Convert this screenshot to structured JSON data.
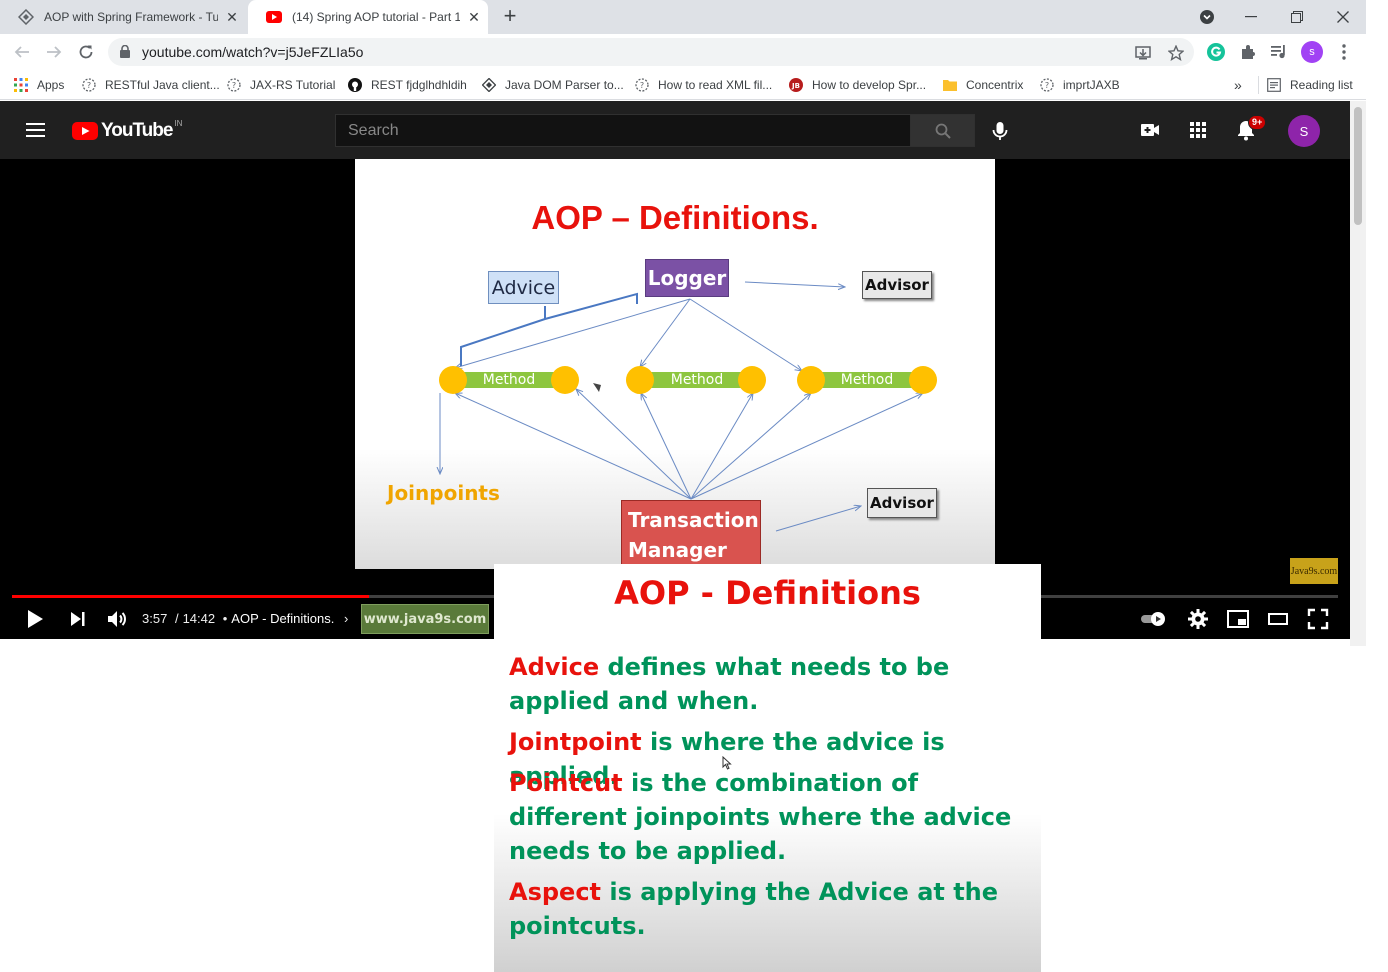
{
  "browser": {
    "tabs": [
      {
        "title": "AOP with Spring Framework - Tu",
        "icon": "spring-favicon",
        "active": false
      },
      {
        "title": "(14) Spring AOP tutorial - Part 1 |",
        "icon": "youtube-favicon",
        "active": true
      }
    ],
    "new_tab_label": "+",
    "url": "youtube.com/watch?v=j5JeFZLIa5o",
    "profile_initial": "s",
    "bookmarks": [
      {
        "label": "Apps",
        "icon": "apps-grid-icon"
      },
      {
        "label": "RESTful Java client...",
        "icon": "page-icon"
      },
      {
        "label": "JAX-RS Tutorial",
        "icon": "page-icon"
      },
      {
        "label": "REST fjdglhdhldih",
        "icon": "github-icon"
      },
      {
        "label": "Java DOM Parser to...",
        "icon": "diamond-icon"
      },
      {
        "label": "How to read XML fil...",
        "icon": "page-icon"
      },
      {
        "label": "How to develop Spr...",
        "icon": "jb-icon"
      },
      {
        "label": "Concentrix",
        "icon": "folder-icon"
      },
      {
        "label": "imprtJAXB",
        "icon": "page-icon"
      }
    ],
    "overflow_label": "»",
    "reading_list_label": "Reading list"
  },
  "youtube": {
    "logo_text": "YouTube",
    "country_code": "IN",
    "search_placeholder": "Search",
    "notification_count": "9+",
    "avatar_initial": "S"
  },
  "player": {
    "time_current": "3:57",
    "time_total": "14:42",
    "time_separator": "/",
    "bullet": "•",
    "chapter": "AOP - Definitions.",
    "progress_fraction": 0.269,
    "site_strip": "www.java9s.com",
    "watermark": "Java9s.com"
  },
  "slide_video": {
    "title": "AOP – Definitions.",
    "advice": "Advice",
    "logger": "Logger",
    "advisor_top": "Advisor",
    "advisor_bottom": "Advisor",
    "method_label": "Method",
    "joinpoints": "Joinpoints",
    "transaction_line1": "Transaction",
    "transaction_line2": "Manager"
  },
  "slide_overlay": {
    "title": "AOP - Definitions",
    "definitions": [
      {
        "term": "Advice",
        "text": " defines what needs to be applied and when."
      },
      {
        "term": "Jointpoint",
        "text": " is where the advice is applied."
      },
      {
        "term": "Pointcut",
        "text": " is the combination of different joinpoints where the advice needs to be applied."
      },
      {
        "term": "Aspect",
        "text": " is applying the Advice at the pointcuts."
      }
    ]
  },
  "colors": {
    "term_red": "#e8120c",
    "definition_green": "#00935a",
    "yt_dark": "#202020",
    "progress_red": "#ff0000"
  }
}
